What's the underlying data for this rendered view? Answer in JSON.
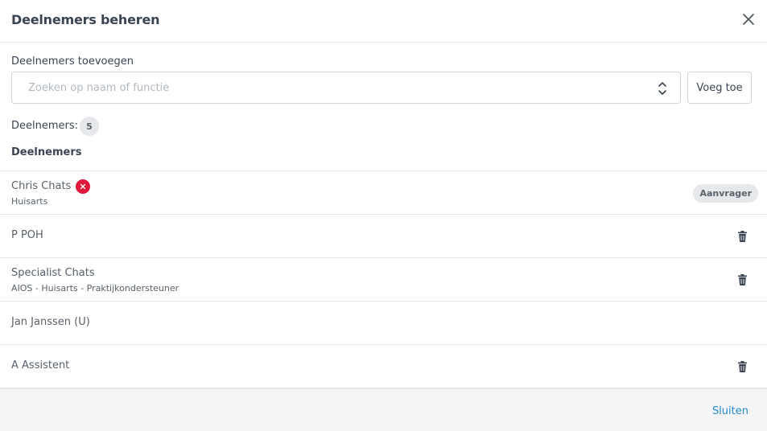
{
  "dialog": {
    "title": "Deelnemers beheren"
  },
  "add": {
    "label": "Deelnemers toevoegen",
    "placeholder": "Zoeken op naam of functie",
    "value": "",
    "button_label": "Voeg toe"
  },
  "count": {
    "label": "Deelnemers:",
    "value": "5"
  },
  "list": {
    "heading": "Deelnemers",
    "participants": [
      {
        "name": "Chris Chats",
        "role": "Huisarts",
        "badge": "Aanvrager",
        "actions": [
          "remove-icon"
        ]
      },
      {
        "name": "P POH",
        "role": "",
        "actions": [
          "trash-icon"
        ]
      },
      {
        "name": "Specialist Chats",
        "role": "AIOS - Huisarts - Praktijkondersteuner",
        "actions": [
          "trash-icon"
        ]
      },
      {
        "name": "Jan Janssen (U)",
        "role": "",
        "actions": []
      },
      {
        "name": "A Assistent",
        "role": "",
        "actions": [
          "trash-icon"
        ]
      }
    ]
  },
  "footer": {
    "close_label": "Sluiten"
  },
  "colors": {
    "accent": "#2a8ac7",
    "danger": "#e0193c",
    "text": "#3b4452",
    "muted_text": "#59616b",
    "badge_bg": "#e6e8eb",
    "footer_bg": "#f4f5f7"
  },
  "icons": [
    "close-icon",
    "updown-chevron-icon",
    "remove-icon",
    "trash-icon"
  ]
}
